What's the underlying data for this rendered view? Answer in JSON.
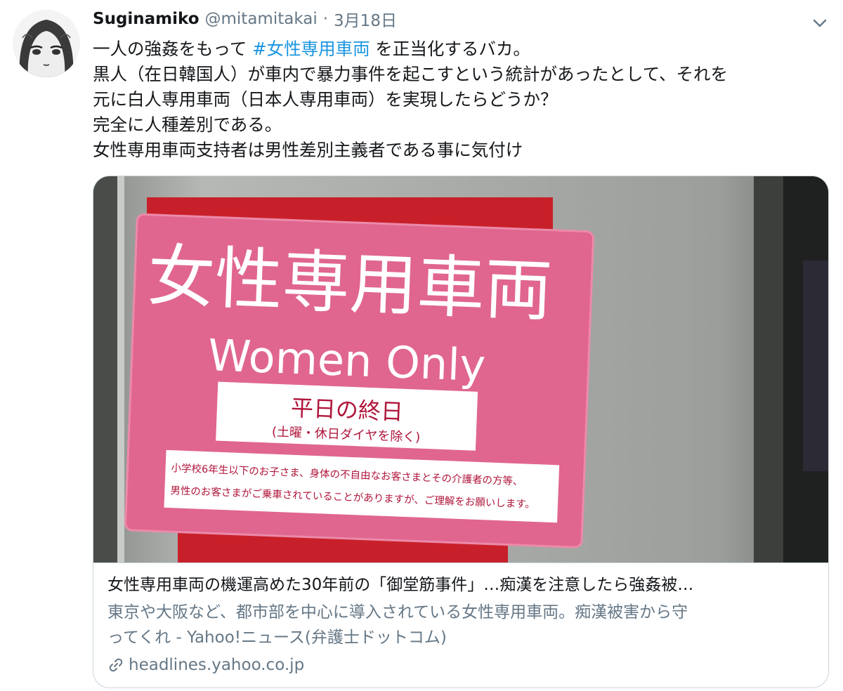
{
  "tweet": {
    "display_name": "Suginamiko",
    "handle": "@mitamitakai",
    "separator": "·",
    "date": "3月18日",
    "text_lines": {
      "l1_before": "一人の強姦をもって ",
      "l1_hashtag": "#女性専用車両",
      "l1_after": " を正当化するバカ。",
      "l2": "黒人（在日韓国人）が車内で暴力事件を起こすという統計があったとして、それを",
      "l3": "元に白人専用車両（日本人専用車両）を実現したらどうか？",
      "l4": "完全に人種差別である。",
      "l5": "女性専用車両支持者は男性差別主義者である事に気付け"
    }
  },
  "card": {
    "title": "女性専用車両の機運高めた30年前の「御堂筋事件」…痴漢を注意したら強姦被…",
    "description_lines": {
      "l1": "東京や大阪など、都市部を中心に導入されている女性専用車両。痴漢被害から守",
      "l2": "ってくれ - Yahoo!ニュース(弁護士ドットコム)"
    },
    "domain": "headlines.yahoo.co.jp",
    "image_sign": {
      "title_jp": "女性専用車両",
      "title_en": "Women Only",
      "schedule": "平日の終日",
      "schedule_note": "(土曜・休日ダイヤを除く)",
      "note_line1": "小学校6年生以下のお子さま、身体の不自由なお客さまとその介護者の方等、",
      "note_line2": "男性のお客さまがご乗車されていることがありますが、ご理解をお願いします。"
    }
  },
  "icons": {
    "caret": "chevron-down-icon",
    "link": "link-icon"
  },
  "colors": {
    "link_blue": "#1b95e0",
    "secondary_text": "#657786",
    "sign_pink": "#e0668f",
    "sign_red": "#c8202a"
  }
}
